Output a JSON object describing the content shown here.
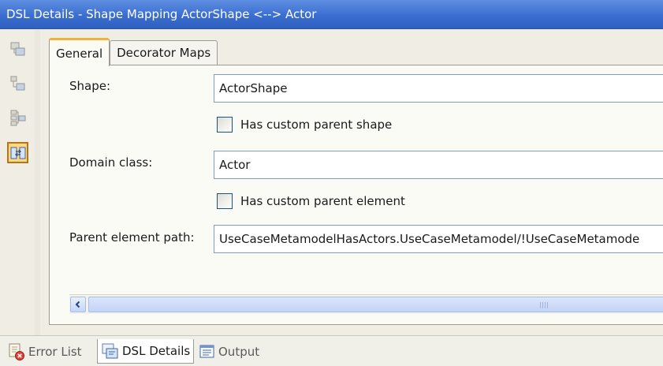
{
  "window": {
    "title": "DSL Details - Shape Mapping ActorShape <--> Actor"
  },
  "toolbar": {
    "buttons": [
      {
        "icon": "tree-view-icon"
      },
      {
        "icon": "class-list-icon"
      },
      {
        "icon": "hierarchy-icon"
      },
      {
        "icon": "shape-mapping-icon",
        "active": true
      }
    ]
  },
  "tabs": [
    {
      "label": "General",
      "active": true
    },
    {
      "label": "Decorator Maps",
      "active": false
    }
  ],
  "form": {
    "shape_label": "Shape:",
    "shape_value": "ActorShape",
    "custom_parent_shape_label": "Has custom parent shape",
    "custom_parent_shape_checked": false,
    "domain_class_label": "Domain class:",
    "domain_class_value": "Actor",
    "custom_parent_element_label": "Has custom parent element",
    "custom_parent_element_checked": false,
    "parent_path_label": "Parent element path:",
    "parent_path_value": "UseCaseMetamodelHasActors.UseCaseMetamodel/!UseCaseMetamode"
  },
  "bottom_tabs": [
    {
      "label": "Error List",
      "icon": "error-list-icon"
    },
    {
      "label": "DSL Details",
      "icon": "dsl-details-icon",
      "active": true
    },
    {
      "label": "Output",
      "icon": "output-icon"
    }
  ],
  "colors": {
    "title_bar": "#3b6ed1",
    "active_tab_accent": "#f3b13a",
    "active_tool_bg": "#fdd87f"
  }
}
